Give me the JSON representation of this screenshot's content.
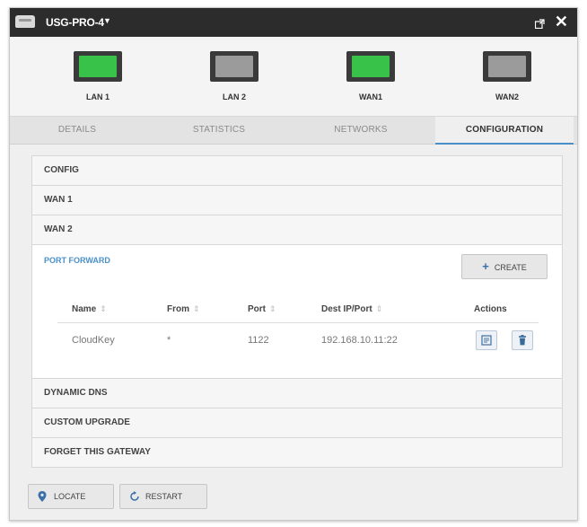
{
  "titlebar": {
    "title": "USG-PRO-4",
    "caret": "▼",
    "close": "✕"
  },
  "ports": [
    {
      "label": "LAN 1",
      "active": true
    },
    {
      "label": "LAN 2",
      "active": false
    },
    {
      "label": "WAN1",
      "active": true
    },
    {
      "label": "WAN2",
      "active": false
    }
  ],
  "tabs": [
    "DETAILS",
    "STATISTICS",
    "NETWORKS",
    "CONFIGURATION"
  ],
  "active_tab": "CONFIGURATION",
  "sections": {
    "config": "CONFIG",
    "wan1": "WAN 1",
    "wan2": "WAN 2",
    "port_forward": "PORT FORWARD",
    "dynamic_dns": "DYNAMIC DNS",
    "custom_upgrade": "CUSTOM UPGRADE",
    "forget": "FORGET THIS GATEWAY"
  },
  "port_forward": {
    "create_label": "CREATE",
    "columns": [
      "Name",
      "From",
      "Port",
      "Dest IP/Port",
      "Actions"
    ],
    "sort_glyph": "⇕",
    "rows": [
      {
        "name": "CloudKey",
        "from": "*",
        "port": "1122",
        "dest": "192.168.10.11:22"
      }
    ]
  },
  "footer": {
    "locate": "LOCATE",
    "restart": "RESTART"
  },
  "colors": {
    "port_active": "#39c24a",
    "port_inactive": "#9b9b9b",
    "accent": "#4a90c8",
    "titlebar": "#2c2c2c"
  },
  "icons": {
    "device": "gateway-device-icon",
    "popout": "popout-icon",
    "close": "close-icon",
    "create": "plus-icon",
    "edit": "edit-icon",
    "delete": "trash-icon",
    "locate": "location-pin-icon",
    "restart": "restart-icon"
  }
}
